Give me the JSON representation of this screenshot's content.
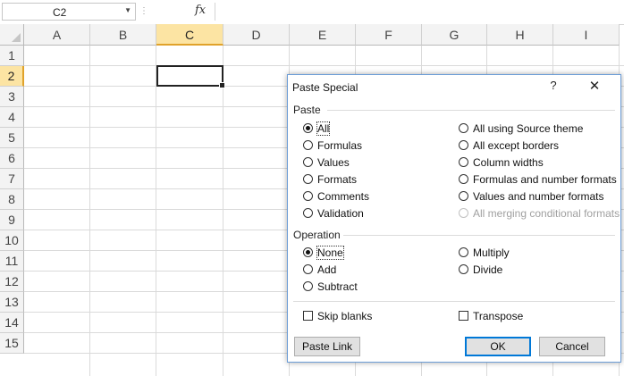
{
  "formula_bar": {
    "name_box": "C2",
    "fx_label": "fx",
    "formula_value": ""
  },
  "sheet": {
    "columns": [
      "A",
      "B",
      "C",
      "D",
      "E",
      "F",
      "G",
      "H",
      "I"
    ],
    "rows": [
      "1",
      "2",
      "3",
      "4",
      "5",
      "6",
      "7",
      "8",
      "9",
      "10",
      "11",
      "12",
      "13",
      "14",
      "15"
    ],
    "selected_column": "C",
    "selected_row": "2"
  },
  "dialog": {
    "title": "Paste Special",
    "help": "?",
    "close": "✕",
    "paste_section": "Paste",
    "paste_left": [
      "All",
      "Formulas",
      "Values",
      "Formats",
      "Comments",
      "Validation"
    ],
    "paste_right": [
      "All using Source theme",
      "All except borders",
      "Column widths",
      "Formulas and number formats",
      "Values and number formats",
      "All merging conditional formats"
    ],
    "paste_selected": "All",
    "paste_disabled": "All merging conditional formats",
    "operation_section": "Operation",
    "operation_left": [
      "None",
      "Add",
      "Subtract"
    ],
    "operation_right": [
      "Multiply",
      "Divide"
    ],
    "operation_selected": "None",
    "skip_blanks": "Skip blanks",
    "transpose": "Transpose",
    "paste_link_button": "Paste Link",
    "ok_button": "OK",
    "cancel_button": "Cancel"
  }
}
